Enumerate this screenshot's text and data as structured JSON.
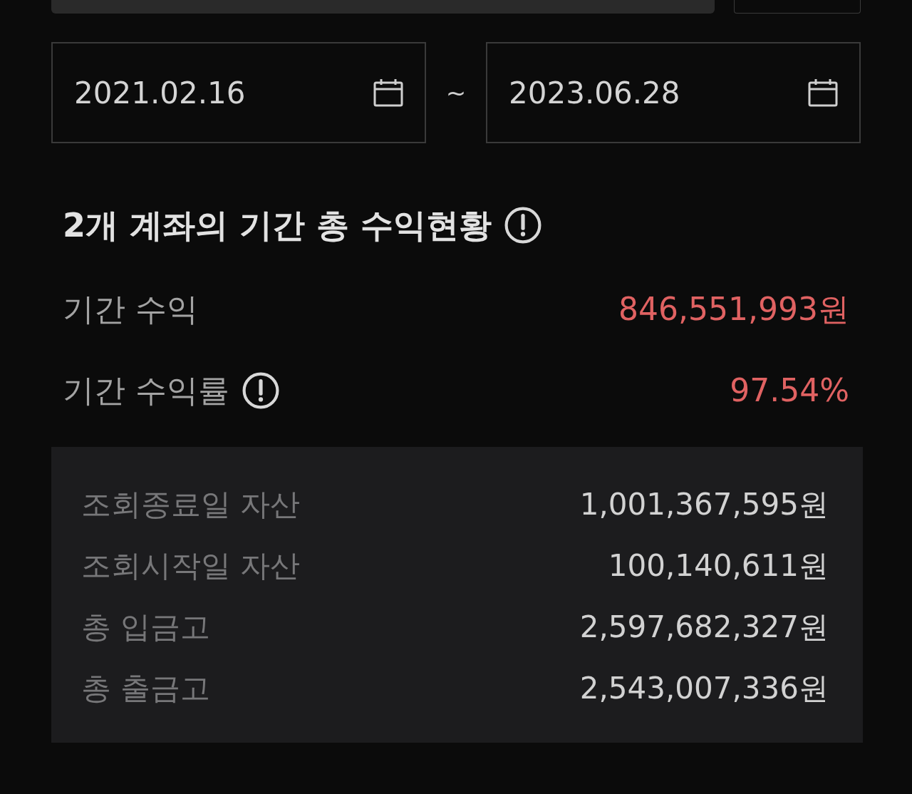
{
  "date_range": {
    "start": "2021.02.16",
    "separator": "~",
    "end": "2023.06.28"
  },
  "summary": {
    "title": "2개 계좌의 기간 총 수익현황",
    "title_info": true,
    "rows": [
      {
        "label": "기간 수익",
        "value": "846,551,993원",
        "info": false
      },
      {
        "label": "기간 수익률",
        "value": "97.54%",
        "info": true
      }
    ]
  },
  "details": [
    {
      "label": "조회종료일 자산",
      "value": "1,001,367,595원"
    },
    {
      "label": "조회시작일 자산",
      "value": "100,140,611원"
    },
    {
      "label": "총 입금고",
      "value": "2,597,682,327원"
    },
    {
      "label": "총 출금고",
      "value": "2,543,007,336원"
    }
  ]
}
